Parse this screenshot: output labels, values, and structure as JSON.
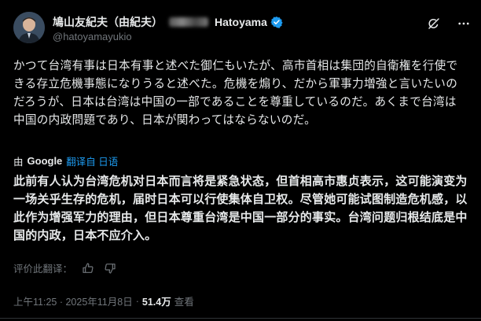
{
  "author": {
    "display_name": "鳩山友紀夫（由紀夫）",
    "display_name_latin": "Hatoyama",
    "handle": "@hatoyamayukio",
    "verified_color": "#1d9bf0"
  },
  "post": {
    "original_text": "かつて台湾有事は日本有事と述べた御仁もいたが、高市首相は集団的自衛権を行使できる存立危機事態になりうると述べた。危機を煽り、だから軍事力増強と言いたいのだろうが、日本は台湾は中国の一部であることを尊重しているのだ。あくまで台湾は中国の内政問題であり、日本が関わってはならないのだ。",
    "translated_by_prefix": "由",
    "translated_by_brand": "Google",
    "translated_from_link": "翻译自 日语",
    "translation": "此前有人认为台湾危机对日本而言将是紧急状态，但首相高市惠贞表示，这可能演变为一场关乎生存的危机，届时日本可以行使集体自卫权。尽管她可能试图制造危机感，以此作为增强军力的理由，但日本尊重台湾是中国一部分的事实。台湾问题归根结底是中国的内政，日本不应介入。",
    "rate_label": "评价此翻译：",
    "timestamp": "上午11:25 · 2025年11月8日",
    "separator": "·",
    "views_count": "51.4万",
    "views_label": "查看"
  },
  "icons": {
    "grok": "grok-icon",
    "more": "more-icon",
    "thumb_up": "thumb-up-icon",
    "thumb_down": "thumb-down-icon",
    "verified": "verified-badge-icon"
  },
  "colors": {
    "background": "#000000",
    "text": "#e7e9ea",
    "muted": "#71767b",
    "link": "#1d9bf0"
  }
}
